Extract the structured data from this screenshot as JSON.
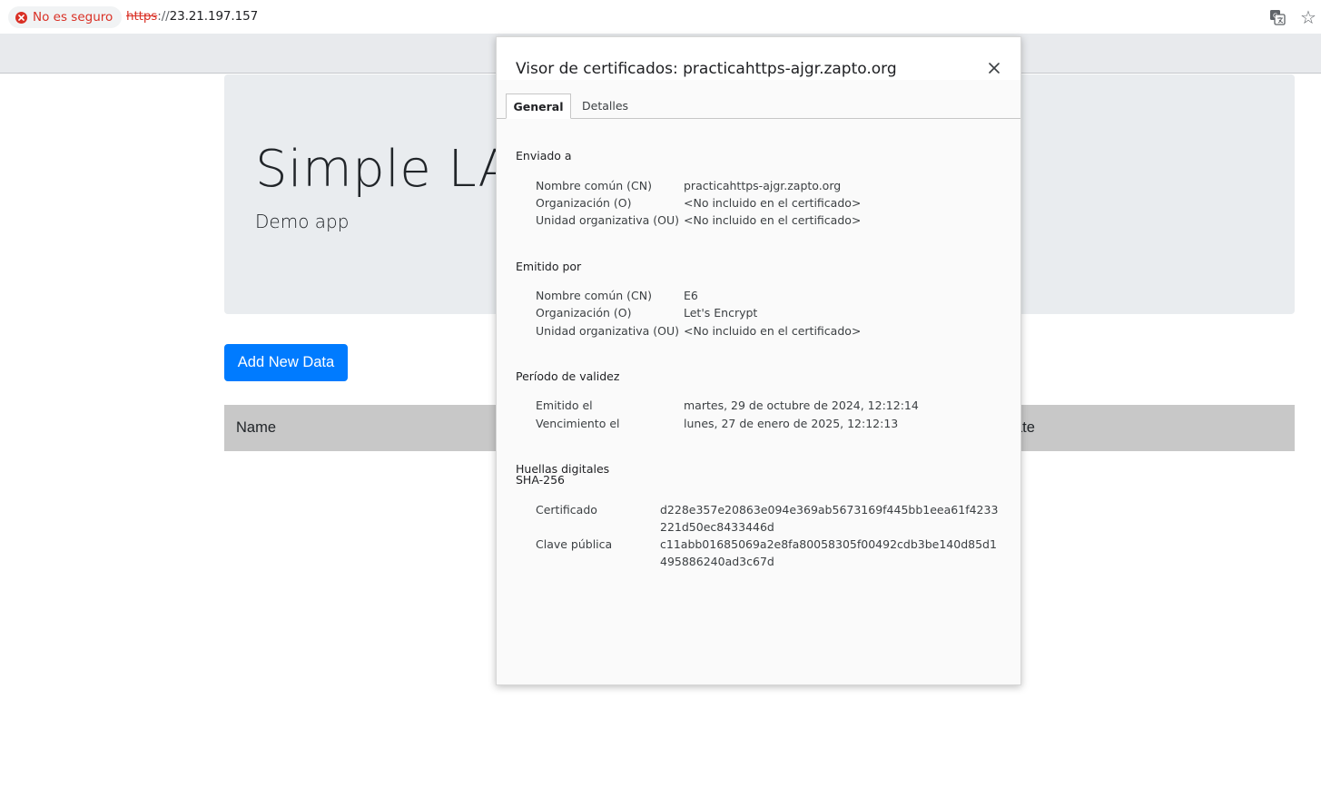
{
  "browser": {
    "security_label": "No es seguro",
    "url_scheme": "https",
    "url_sep": "://",
    "url_host": "23.21.197.157",
    "icons": {
      "security": "error-icon",
      "translate": "translate-icon",
      "bookmark": "star-icon"
    },
    "colors": {
      "danger": "#d93025"
    }
  },
  "page": {
    "title": "Simple LAMP",
    "subtitle": "Demo app",
    "add_button": "Add New Data",
    "table_headers": {
      "name": "Name",
      "date": "ate"
    },
    "colors": {
      "primary": "#007bff",
      "jumbotron": "#e9ecef",
      "table_head": "#c8c8c8"
    }
  },
  "dialog": {
    "title": "Visor de certificados: practicahttps-ajgr.zapto.org",
    "tabs": [
      "General",
      "Detalles"
    ],
    "issued_to": {
      "title": "Enviado a",
      "rows": [
        {
          "label": "Nombre común (CN)",
          "value": "practicahttps-ajgr.zapto.org"
        },
        {
          "label": "Organización (O)",
          "value": "<No incluido en el certificado>"
        },
        {
          "label": "Unidad organizativa (OU)",
          "value": "<No incluido en el certificado>"
        }
      ]
    },
    "issued_by": {
      "title": "Emitido por",
      "rows": [
        {
          "label": "Nombre común (CN)",
          "value": "E6"
        },
        {
          "label": "Organización (O)",
          "value": "Let's Encrypt"
        },
        {
          "label": "Unidad organizativa (OU)",
          "value": "<No incluido en el certificado>"
        }
      ]
    },
    "validity": {
      "title": "Período de validez",
      "rows": [
        {
          "label": "Emitido el",
          "value": "martes, 29 de octubre de 2024, 12:12:14"
        },
        {
          "label": "Vencimiento el",
          "value": "lunes, 27 de enero de 2025, 12:12:13"
        }
      ]
    },
    "fingerprints": {
      "title": "Huellas digitales SHA-256",
      "rows": [
        {
          "label": "Certificado",
          "value": "d228e357e20863e094e369ab5673169f445bb1eea61f4233221d50ec8433446d"
        },
        {
          "label": "Clave pública",
          "value": "c11abb01685069a2e8fa80058305f00492cdb3be140d85d1495886240ad3c67d"
        }
      ]
    }
  }
}
